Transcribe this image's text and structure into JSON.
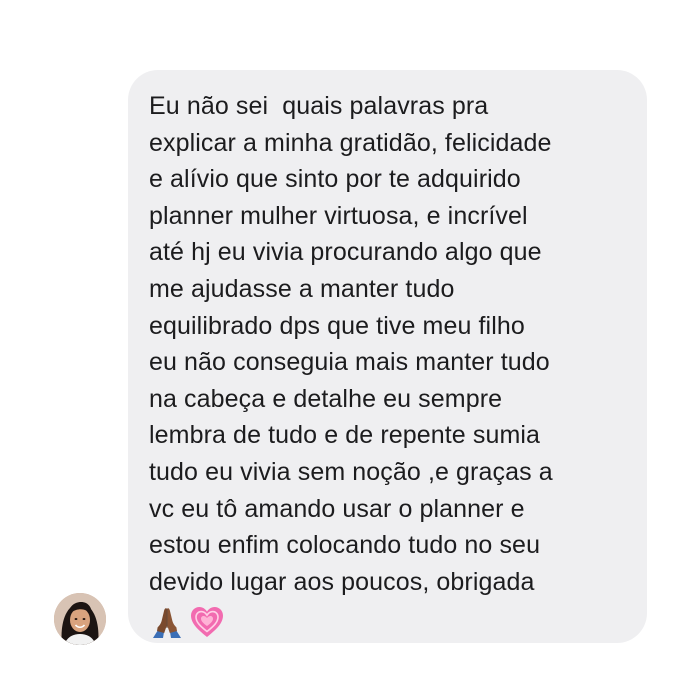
{
  "chat": {
    "message": {
      "lines": [
        "Eu não sei  quais palavras pra",
        "explicar a minha gratidão, felicidade",
        "e alívio que sinto por te adquirido",
        "planner mulher virtuosa, e incrível",
        "até hj eu vivia procurando algo que",
        "me ajudasse a manter tudo",
        "equilibrado dps que tive meu filho",
        "eu não conseguia mais manter tudo",
        "na cabeça e detalhe eu sempre",
        "lembra de tudo e de repente sumia",
        "tudo eu vivia sem noção ,e graças a",
        "vc eu tô amando usar o planner e",
        "estou enfim colocando tudo no seu",
        "devido lugar aos poucos, obrigada"
      ],
      "emojis": [
        "praying-hands-icon",
        "growing-heart-icon"
      ]
    },
    "sender_avatar": "avatar",
    "colors": {
      "bubble": "#efeff1",
      "text": "#1c1c1e",
      "heart": "#f26bb0",
      "hands": "#7a4a2e"
    }
  }
}
